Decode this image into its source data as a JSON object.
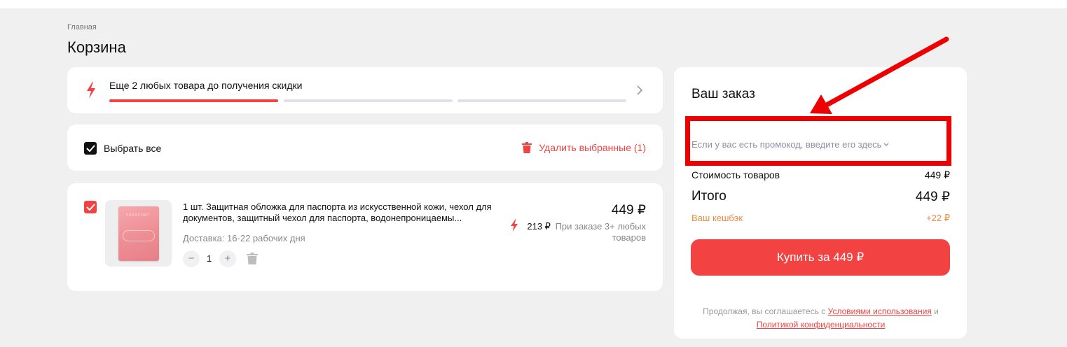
{
  "breadcrumb": "Главная",
  "page_title": "Корзина",
  "promo_banner": {
    "text": "Еще 2 любых товара до получения скидки",
    "progress": [
      1,
      0,
      0
    ]
  },
  "selection": {
    "select_all_label": "Выбрать все",
    "delete_selected_label": "Удалить выбранные (1)"
  },
  "cart_items": [
    {
      "title": "1 шт. Защитная обложка для паспорта из искусственной кожи, чехол для документов, защитный чехол для паспорта, водонепроницаемы...",
      "delivery": "Доставка: 16-22 рабочих дня",
      "quantity": "1",
      "qty_minus": "−",
      "qty_plus": "+",
      "price": "449 ₽",
      "discount_price": "213 ₽",
      "discount_condition": "При заказе 3+ любых товаров",
      "thumb_word": "PASSPORT",
      "selected": true
    }
  ],
  "summary": {
    "title": "Ваш заказ",
    "promo_prompt": "Если у вас есть промокод, введите его здесь",
    "cost_label": "Стоимость товаров",
    "cost_value": "449 ₽",
    "total_label": "Итого",
    "total_value": "449 ₽",
    "cashback_label": "Ваш кешбэк",
    "cashback_value": "+22 ₽",
    "buy_button": "Купить за 449 ₽",
    "terms_prefix": "Продолжая, вы соглашаетесь с",
    "terms_link": "Условиями использования",
    "terms_and": "и",
    "privacy_link": "Политикой конфиденциальности"
  },
  "colors": {
    "accent": "#f24242",
    "cashback": "#f08a3c",
    "annotation": "#ee0000",
    "background": "#f0f0f0"
  },
  "icons": {
    "bolt": "lightning-icon",
    "chevron": "chevron-right-icon",
    "trash": "trash-icon",
    "check": "check-icon",
    "dropdown": "chevron-down-icon"
  }
}
